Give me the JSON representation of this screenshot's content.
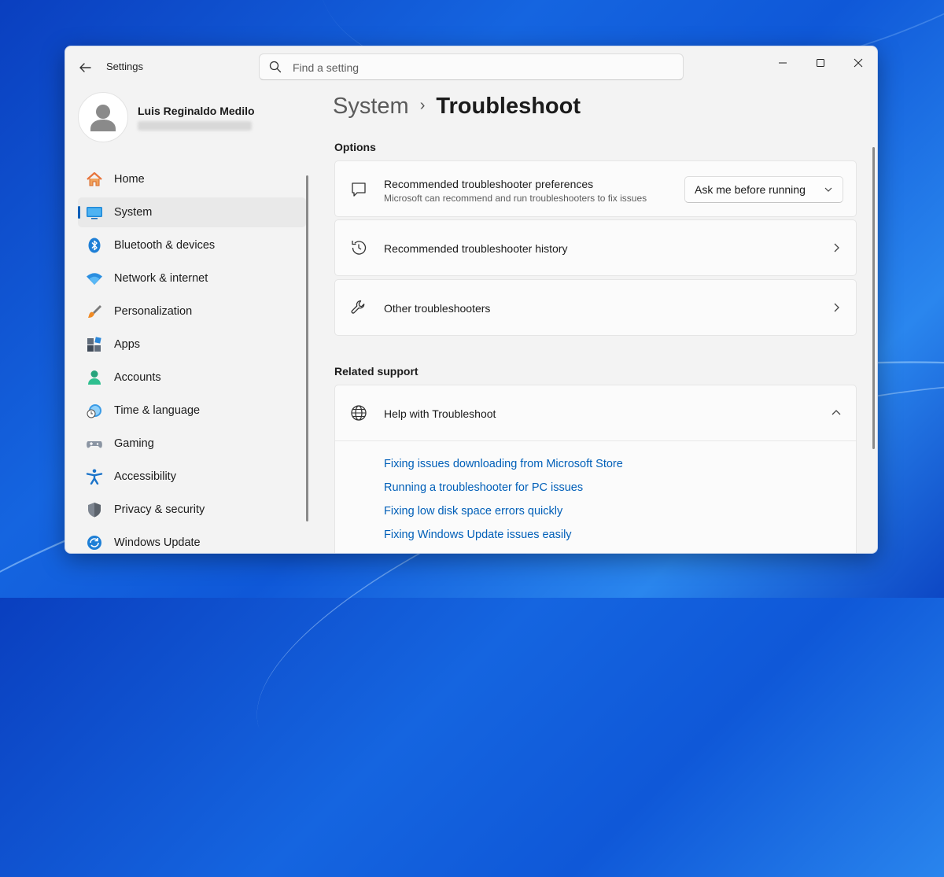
{
  "window": {
    "app_title": "Settings",
    "search_placeholder": "Find a setting"
  },
  "profile": {
    "name": "Luis Reginaldo Medilo"
  },
  "sidebar": {
    "items": [
      {
        "label": "Home",
        "icon": "home-icon"
      },
      {
        "label": "System",
        "icon": "system-icon",
        "active": true
      },
      {
        "label": "Bluetooth & devices",
        "icon": "bluetooth-icon"
      },
      {
        "label": "Network & internet",
        "icon": "wifi-icon"
      },
      {
        "label": "Personalization",
        "icon": "brush-icon"
      },
      {
        "label": "Apps",
        "icon": "apps-icon"
      },
      {
        "label": "Accounts",
        "icon": "accounts-icon"
      },
      {
        "label": "Time & language",
        "icon": "clock-globe-icon"
      },
      {
        "label": "Gaming",
        "icon": "gamepad-icon"
      },
      {
        "label": "Accessibility",
        "icon": "accessibility-icon"
      },
      {
        "label": "Privacy & security",
        "icon": "shield-icon"
      },
      {
        "label": "Windows Update",
        "icon": "update-icon"
      }
    ]
  },
  "breadcrumb": {
    "parent": "System",
    "separator": "›",
    "current": "Troubleshoot"
  },
  "options": {
    "heading": "Options",
    "preferences": {
      "title": "Recommended troubleshooter preferences",
      "subtitle": "Microsoft can recommend and run troubleshooters to fix issues",
      "dropdown_value": "Ask me before running"
    },
    "history": {
      "title": "Recommended troubleshooter history"
    },
    "other": {
      "title": "Other troubleshooters"
    }
  },
  "related": {
    "heading": "Related support",
    "help_title": "Help with Troubleshoot",
    "links": [
      "Fixing issues downloading from Microsoft Store",
      "Running a troubleshooter for PC issues",
      "Fixing low disk space errors quickly",
      "Fixing Windows Update issues easily"
    ]
  },
  "colors": {
    "accent": "#005fb8",
    "link": "#005fb8"
  }
}
